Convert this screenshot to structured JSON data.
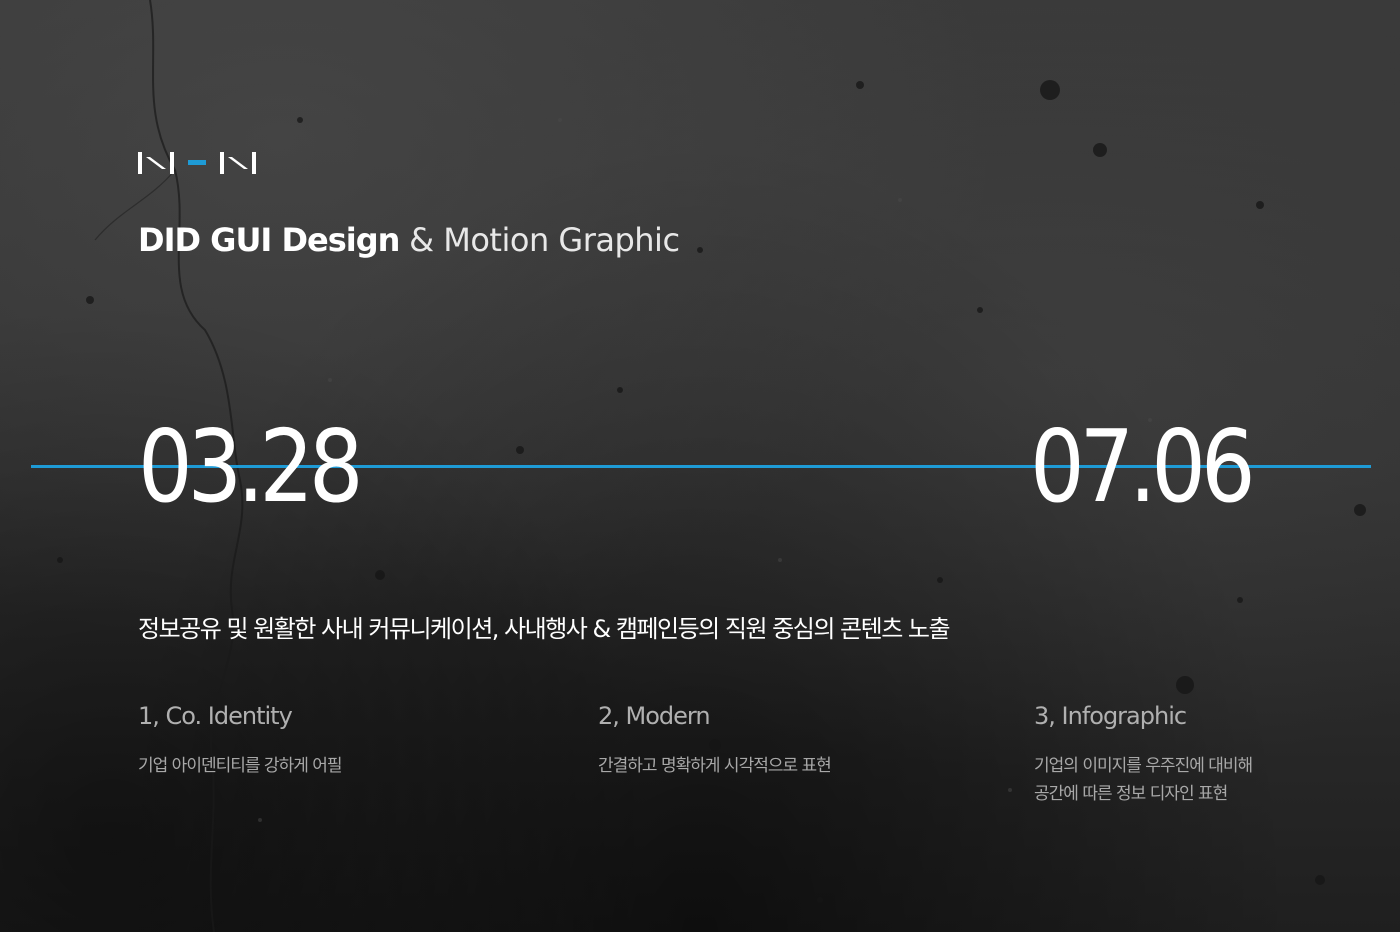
{
  "brand": {
    "logo_icon": "nhn-logo-icon",
    "logo_text": "NHN",
    "accent_color": "#1e9bd6"
  },
  "headline": {
    "strong": "DID GUI Design",
    "light": "& Motion Graphic"
  },
  "timeline": {
    "start_date": "03.28",
    "end_date": "07.06",
    "line_color": "#1e9bd6"
  },
  "summary": "정보공유 및 원활한 사내 커뮤니케이션, 사내행사 & 캠페인등의 직원 중심의 콘텐츠 노출",
  "features": [
    {
      "title": "1, Co. Identity",
      "lines": [
        "기업 아이덴티티를 강하게 어필"
      ]
    },
    {
      "title": "2, Modern",
      "lines": [
        "간결하고 명확하게 시각적으로 표현"
      ]
    },
    {
      "title": "3, Infographic",
      "lines": [
        "기업의 이미지를 우주진에 대비해",
        "공간에 따른 정보 디자인 표현"
      ]
    }
  ]
}
